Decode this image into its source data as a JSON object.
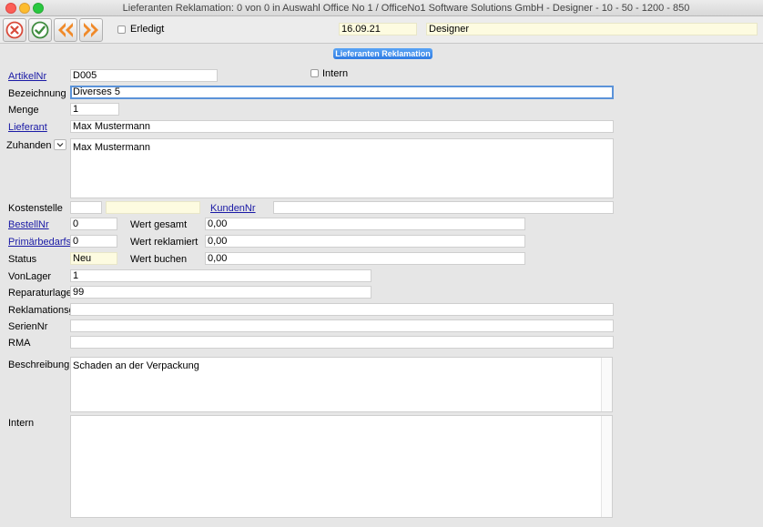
{
  "window": {
    "title": "Lieferanten Reklamation: 0 von 0 in Auswahl Office No 1 /  OfficeNo1 Software Solutions GmbH - Designer - 10 - 50 - 1200 - 850"
  },
  "toolbar": {
    "erledigt_label": "Erledigt",
    "date": "16.09.21",
    "user": "Designer"
  },
  "section": {
    "title": "Lieferanten Reklamation"
  },
  "form": {
    "artikelnr": {
      "label": "ArtikelNr",
      "value": "D005"
    },
    "intern_checkbox_label": "Intern",
    "bezeichnung": {
      "label": "Bezeichnung",
      "value": "Diverses 5"
    },
    "menge": {
      "label": "Menge",
      "value": "1"
    },
    "lieferant": {
      "label": "Lieferant",
      "value": "Max Mustermann"
    },
    "zuhanden": {
      "label": "Zuhanden",
      "value": "Max Mustermann"
    },
    "kostenstelle": {
      "label": "Kostenstelle",
      "value": "",
      "value2": ""
    },
    "kundennr": {
      "label": "KundenNr",
      "value": ""
    },
    "bestellnr": {
      "label": "BestellNr",
      "value": "0"
    },
    "wert_gesamt": {
      "label": "Wert gesamt",
      "value": "0,00"
    },
    "primaerbedarfs": {
      "label": "Primärbedarfs",
      "value": "0"
    },
    "wert_reklamiert": {
      "label": "Wert reklamiert",
      "value": "0,00"
    },
    "status": {
      "label": "Status",
      "value": "Neu"
    },
    "wert_buchen": {
      "label": "Wert buchen",
      "value": "0,00"
    },
    "vonlager": {
      "label": "VonLager",
      "value": "1"
    },
    "reparaturlager": {
      "label": "Reparaturlager",
      "value": "99"
    },
    "reklamationsg": {
      "label": "Reklamationsg",
      "value": ""
    },
    "seriennr": {
      "label": "SerienNr",
      "value": ""
    },
    "rma": {
      "label": "RMA",
      "value": ""
    },
    "beschreibung": {
      "label": "Beschreibung",
      "value": "Schaden an der Verpackung"
    },
    "intern": {
      "label": "Intern",
      "value": ""
    }
  },
  "colors": {
    "accent": "#2e7be3",
    "link": "#1a1aa6",
    "highlight_field": "#fdfbe0"
  }
}
